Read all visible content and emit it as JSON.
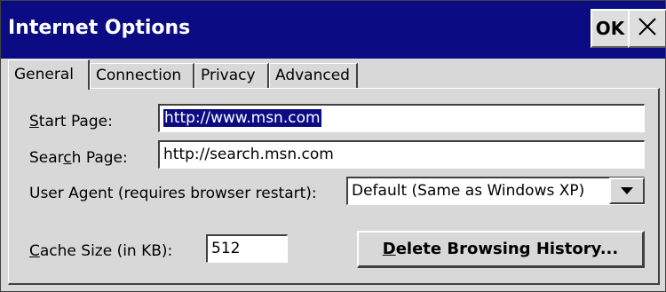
{
  "window": {
    "title": "Internet Options",
    "ok_label": "OK",
    "close_icon": "close-icon"
  },
  "tabs": [
    {
      "label": "General",
      "active": true
    },
    {
      "label": "Connection",
      "active": false
    },
    {
      "label": "Privacy",
      "active": false
    },
    {
      "label": "Advanced",
      "active": false
    }
  ],
  "form": {
    "start_page": {
      "label_underline": "S",
      "label_rest": "tart Page:",
      "value": "http://www.msn.com"
    },
    "search_page": {
      "label_prefix": "Sear",
      "label_underline": "c",
      "label_rest": "h Page:",
      "value": "http://search.msn.com"
    },
    "user_agent": {
      "label": "User Agent (requires browser restart):",
      "selected": "Default (Same as Windows XP)"
    },
    "cache_size": {
      "label_underline": "C",
      "label_rest": "ache Size (in KB):",
      "value": "512"
    },
    "delete_history": {
      "label_underline": "D",
      "label_rest": "elete Browsing History..."
    }
  },
  "colors": {
    "titlebar": "#0b0c84",
    "face": "#d8d8d8",
    "selection": "#0b0c84"
  }
}
